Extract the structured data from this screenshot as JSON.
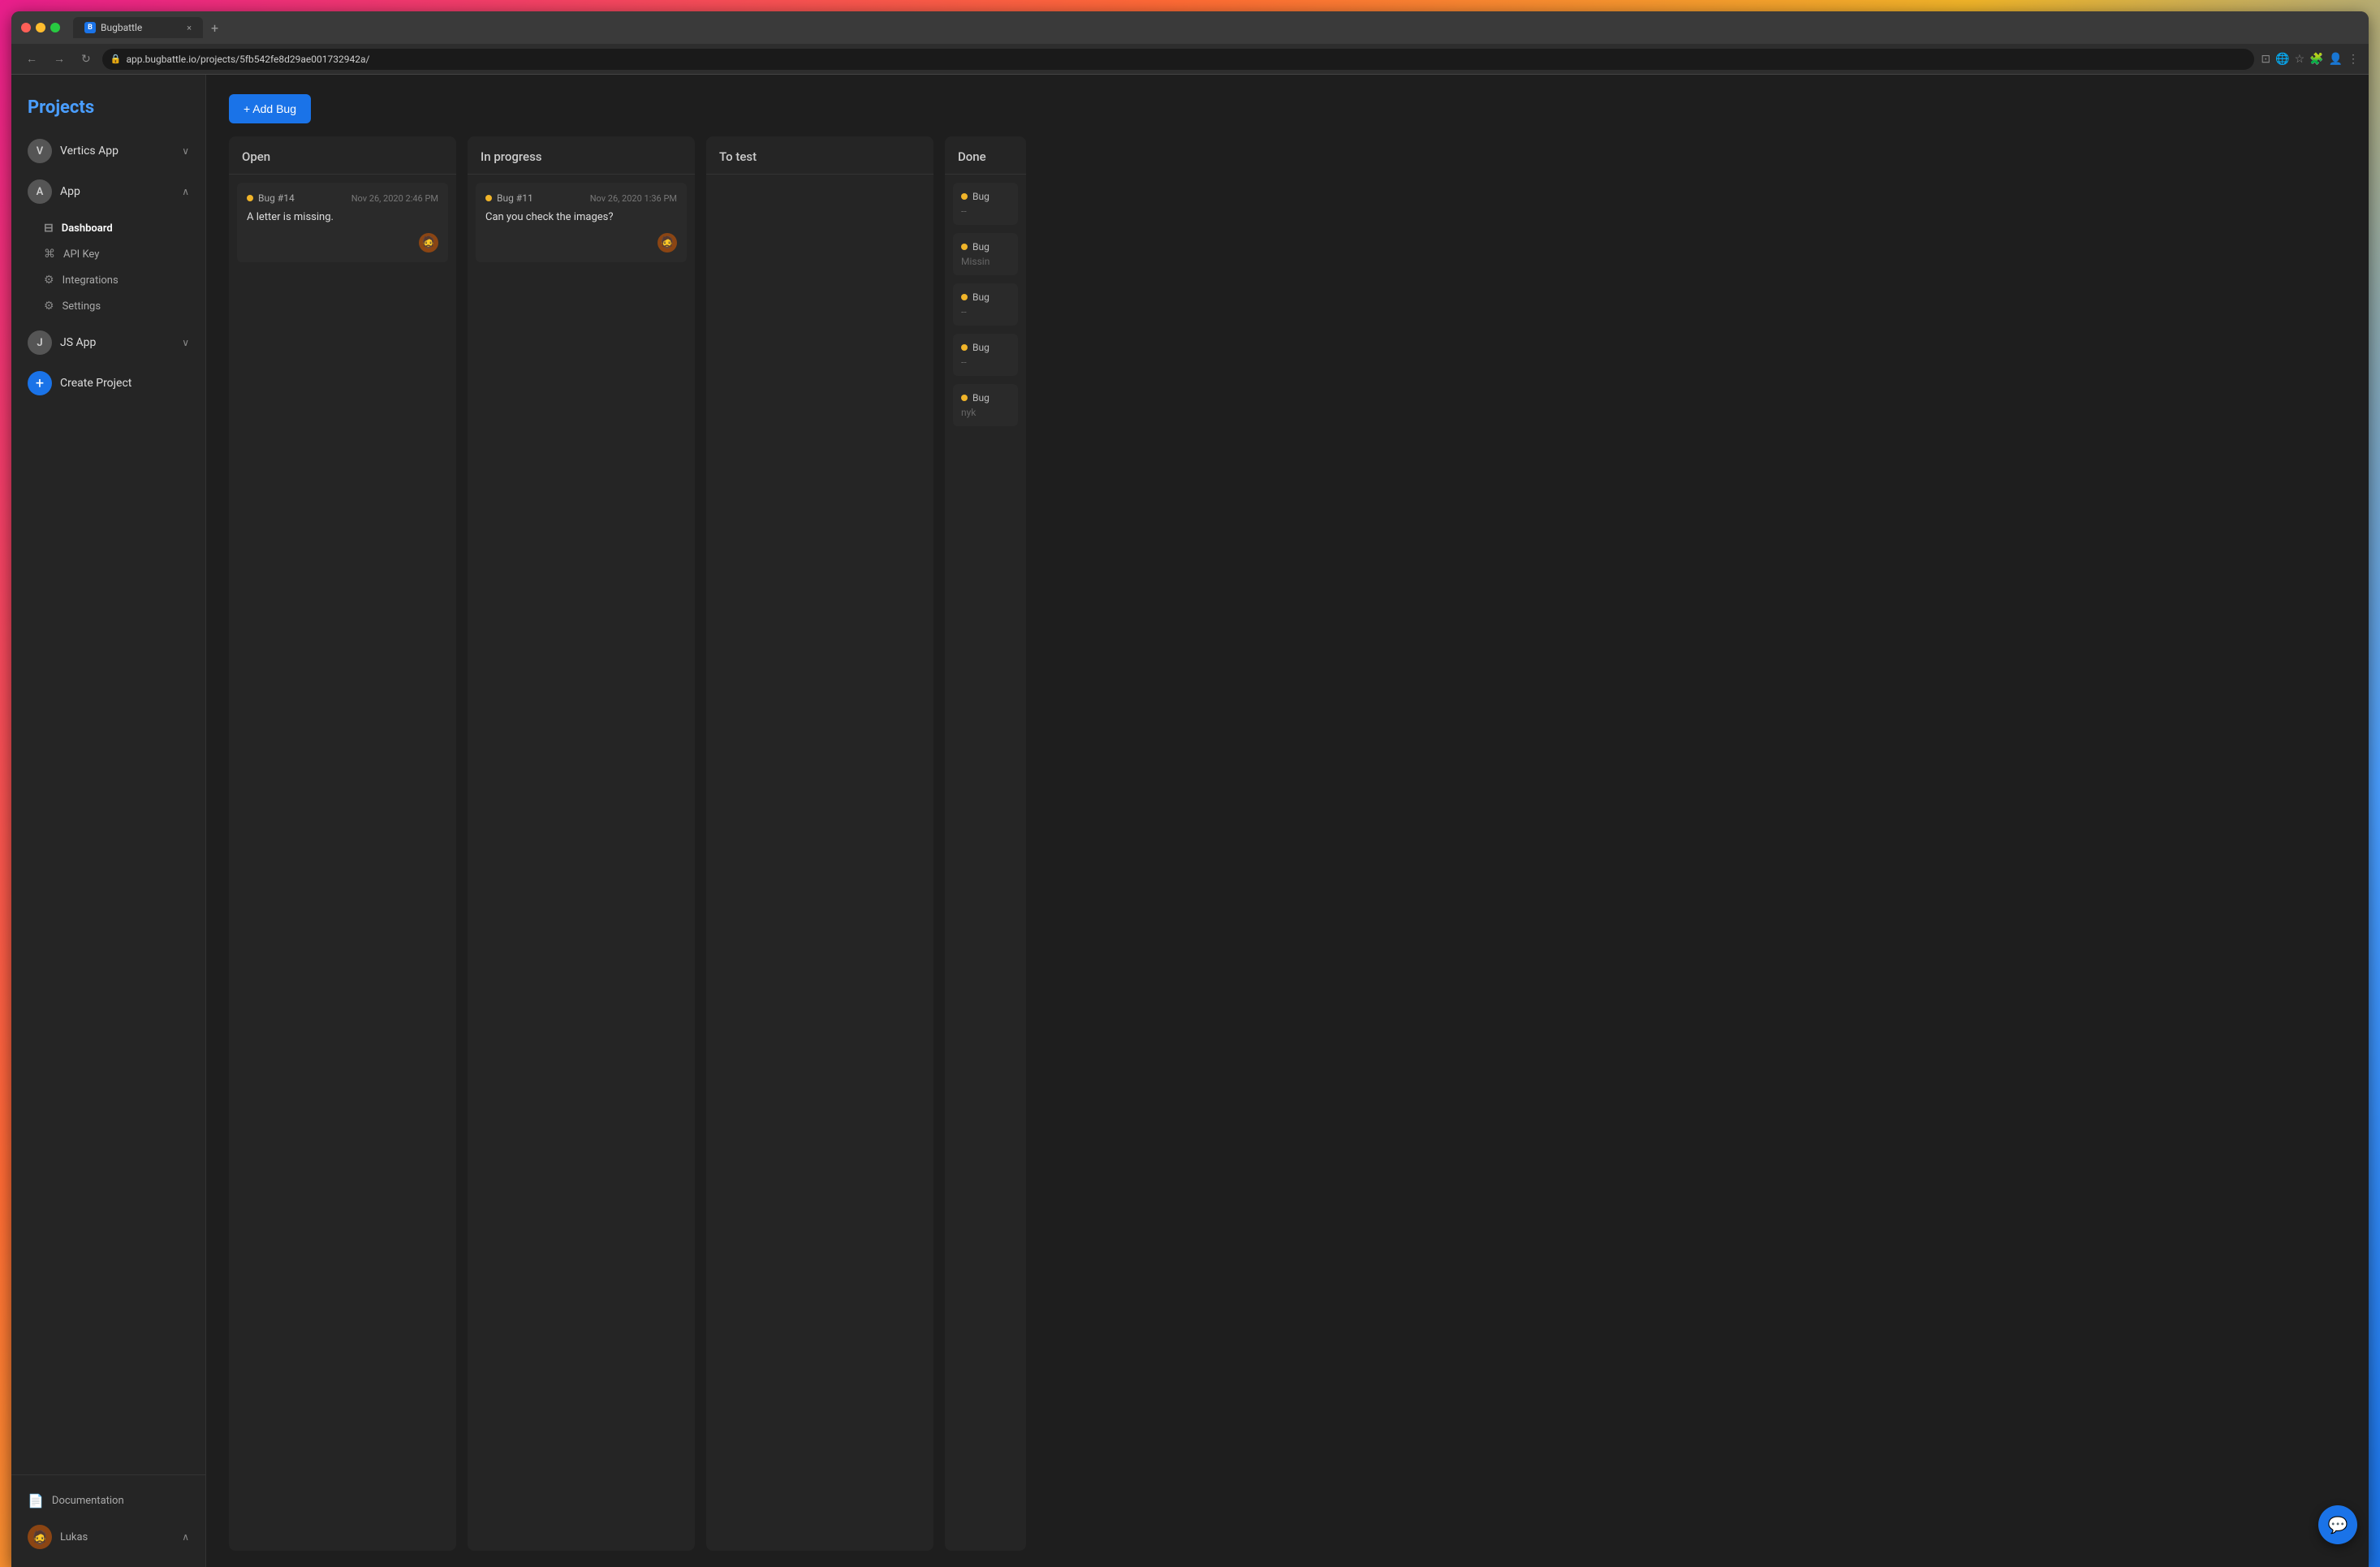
{
  "browser": {
    "tab_title": "Bugbattle",
    "tab_close": "×",
    "tab_new": "+",
    "url": "app.bugbattle.io/projects/5fb542fe8d29ae001732942a/",
    "favicon_text": "B"
  },
  "nav": {
    "back": "←",
    "forward": "→",
    "refresh": "↻"
  },
  "sidebar": {
    "title": "Projects",
    "projects": [
      {
        "avatar_letter": "V",
        "name": "Vertics App",
        "chevron": "∨",
        "expanded": false
      },
      {
        "avatar_letter": "A",
        "name": "App",
        "chevron": "∧",
        "expanded": true
      },
      {
        "avatar_letter": "J",
        "name": "JS App",
        "chevron": "∨",
        "expanded": false
      }
    ],
    "sub_menu": [
      {
        "icon": "⊟",
        "label": "Dashboard",
        "active": true
      },
      {
        "icon": "⌘",
        "label": "API Key",
        "active": false
      },
      {
        "icon": "⚙",
        "label": "Integrations",
        "active": false
      },
      {
        "icon": "⚙",
        "label": "Settings",
        "active": false
      }
    ],
    "create_project": "Create Project",
    "documentation": "Documentation",
    "user": "Lukas",
    "user_chevron": "∧"
  },
  "toolbar": {
    "add_bug_label": "+ Add Bug"
  },
  "columns": [
    {
      "id": "open",
      "title": "Open",
      "cards": [
        {
          "bug_id": "Bug #14",
          "date": "Nov 26, 2020 2:46 PM",
          "title": "A letter is missing.",
          "has_avatar": true
        }
      ]
    },
    {
      "id": "in_progress",
      "title": "In progress",
      "cards": [
        {
          "bug_id": "Bug #11",
          "date": "Nov 26, 2020 1:36 PM",
          "title": "Can you check the images?",
          "has_avatar": true
        }
      ]
    },
    {
      "id": "to_test",
      "title": "To test",
      "cards": []
    },
    {
      "id": "done",
      "title": "Done",
      "cards": [
        {
          "bug_id": "Bug",
          "sub": "--"
        },
        {
          "bug_id": "Bug",
          "sub": "Missin"
        },
        {
          "bug_id": "Bug",
          "sub": "--"
        },
        {
          "bug_id": "Bug",
          "sub": "--"
        },
        {
          "bug_id": "Bug",
          "sub": "nyk"
        }
      ]
    }
  ],
  "chat_icon": "💬",
  "colors": {
    "accent_blue": "#1a73e8",
    "bug_dot": "#f0b429",
    "sidebar_bg": "#252525",
    "card_bg": "#2a2a2a",
    "main_bg": "#1e1e1e"
  }
}
